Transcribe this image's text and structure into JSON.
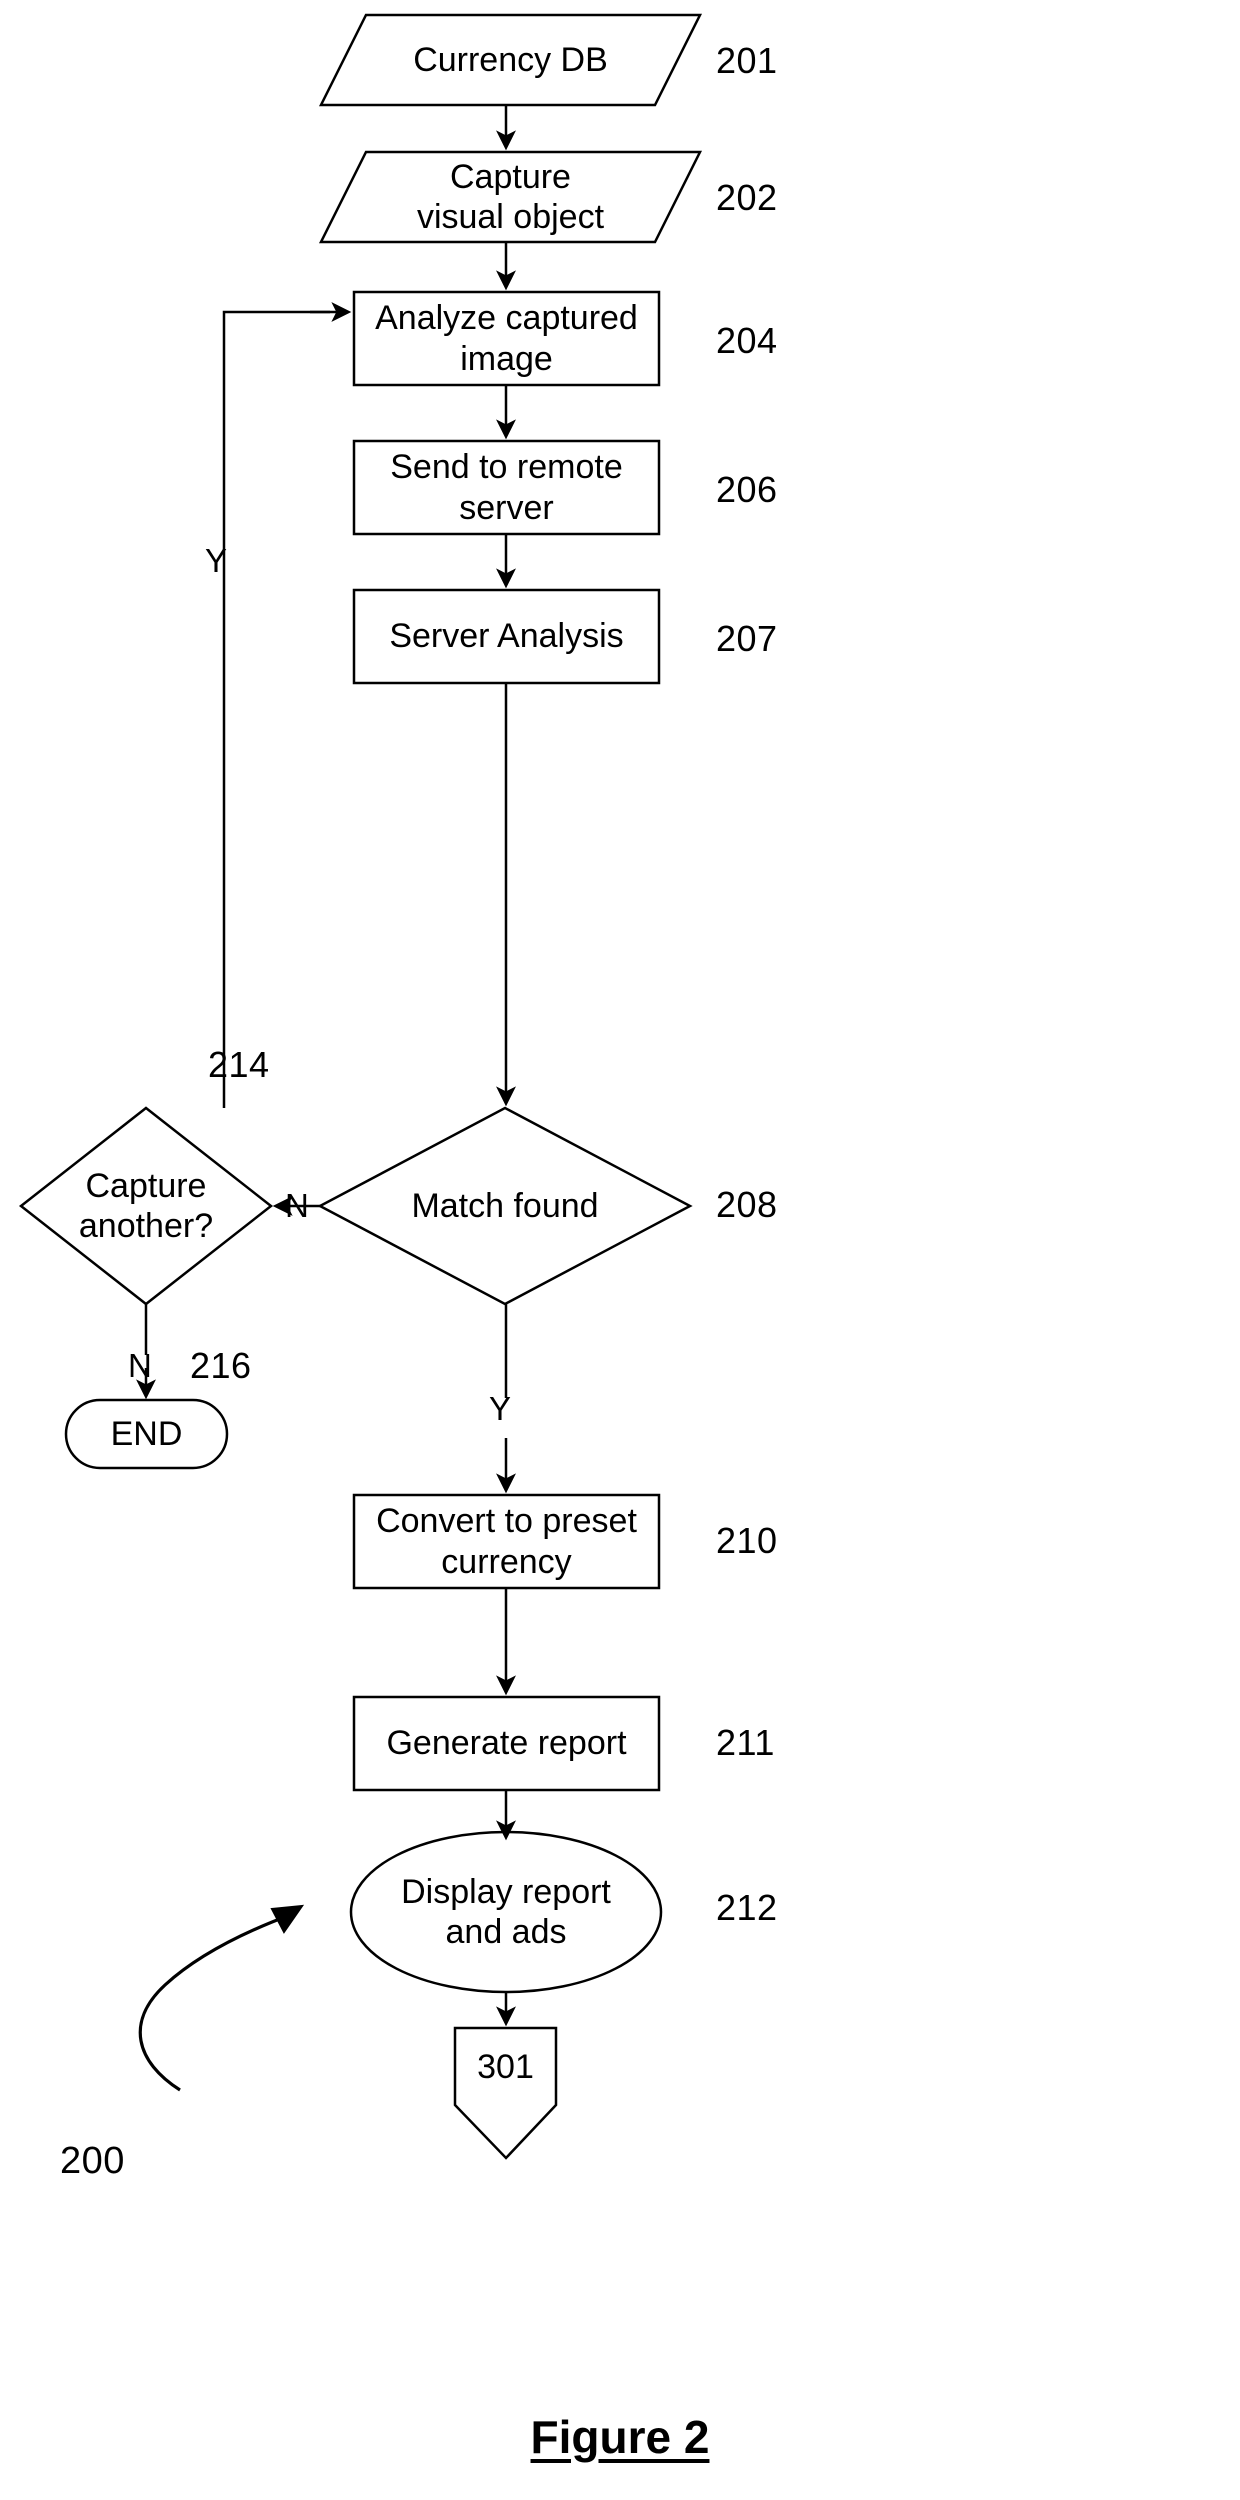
{
  "figure": {
    "caption": "Figure 2",
    "diagram_ref": "200"
  },
  "nodes": [
    {
      "id": "currency_db",
      "label": "Currency DB",
      "ref": "201",
      "shape": "parallelogram"
    },
    {
      "id": "capture",
      "label": "Capture\nvisual object",
      "ref": "202",
      "shape": "parallelogram"
    },
    {
      "id": "analyze",
      "label": "Analyze captured\nimage",
      "ref": "204",
      "shape": "rectangle"
    },
    {
      "id": "send",
      "label": "Send to remote\nserver",
      "ref": "206",
      "shape": "rectangle"
    },
    {
      "id": "server",
      "label": "Server Analysis",
      "ref": "207",
      "shape": "rectangle"
    },
    {
      "id": "capture_again",
      "label": "Capture\nanother?",
      "ref": "214",
      "shape": "diamond"
    },
    {
      "id": "match",
      "label": "Match found",
      "ref": "208",
      "shape": "diamond"
    },
    {
      "id": "end",
      "label": "END",
      "ref": "216",
      "shape": "stadium"
    },
    {
      "id": "convert",
      "label": "Convert to preset\ncurrency",
      "ref": "210",
      "shape": "rectangle"
    },
    {
      "id": "report",
      "label": "Generate report",
      "ref": "211",
      "shape": "rectangle"
    },
    {
      "id": "display",
      "label": "Display report\nand ads",
      "ref": "212",
      "shape": "ellipse"
    },
    {
      "id": "connector",
      "label": "301",
      "ref": "",
      "shape": "offpage-connector"
    }
  ],
  "edge_labels": {
    "capture_again_yes": "Y",
    "match_no": "N",
    "capture_again_no": "N",
    "match_yes": "Y"
  },
  "colors": {
    "stroke": "#000000",
    "fill": "#ffffff",
    "text": "#000000"
  }
}
